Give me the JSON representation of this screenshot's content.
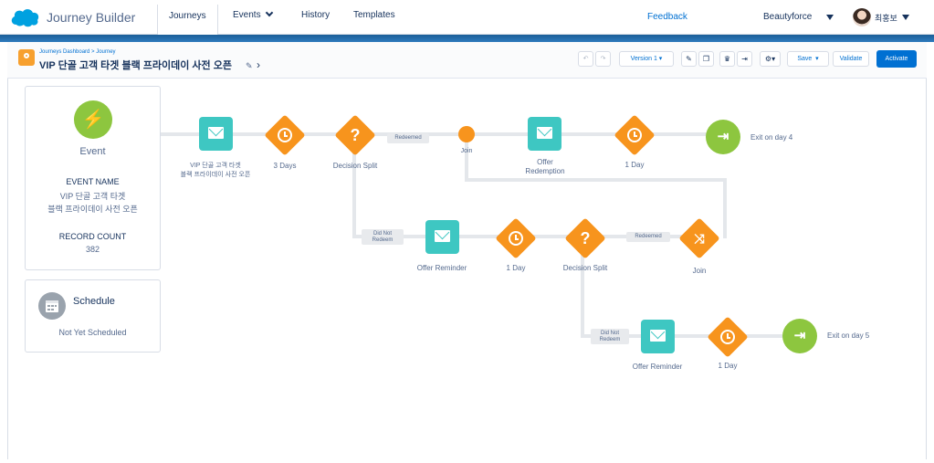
{
  "nav": {
    "app_title": "Journey Builder",
    "tabs": [
      "Journeys",
      "Events",
      "History",
      "Templates"
    ],
    "feedback": "Feedback",
    "org": "Beautyforce",
    "user": "최홍보"
  },
  "header": {
    "breadcrumb": "Journeys Dashboard > Journey",
    "title": "VIP 단골 고객 타겟 블랙 프라이데이 사전 오픈",
    "version": "Version 1",
    "save": "Save",
    "validate": "Validate",
    "activate": "Activate"
  },
  "event_card": {
    "label": "Event",
    "name_heading": "EVENT NAME",
    "name_line1": "VIP 단골 고객 타겟",
    "name_line2": "블랙 프라이데이 사전 오픈",
    "count_heading": "RECORD COUNT",
    "count": "382"
  },
  "schedule_card": {
    "label": "Schedule",
    "status": "Not Yet Scheduled"
  },
  "flow": {
    "email1_line1": "VIP 단골 고객 타겟",
    "email1_line2": "블랙 프라이데이 사전 오픈",
    "wait1": "3 Days",
    "split1": "Decision Split",
    "redeemed1": "Redeemed",
    "join1": "Join",
    "offer_line1": "Offer",
    "offer_line2": "Redemption",
    "wait2": "1 Day",
    "exit1": "Exit on day 4",
    "did_not1_line1": "Did Not",
    "did_not1_line2": "Redeem",
    "reminder1": "Offer Reminder",
    "wait3": "1 Day",
    "split2": "Decision Split",
    "redeemed2": "Redeemed",
    "join2": "Join",
    "did_not2_line1": "Did Not",
    "did_not2_line2": "Redeem",
    "reminder2": "Offer Reminder",
    "wait4": "1 Day",
    "exit2": "Exit on day 5"
  },
  "icons": {
    "logo": "salesforce-cloud-icon",
    "event": "lightning-bolt-icon",
    "schedule": "calendar-icon",
    "email": "envelope-icon",
    "wait": "clock-icon",
    "split": "question-mark-icon",
    "join": "merge-icon",
    "exit": "exit-door-icon"
  },
  "colors": {
    "accent_blue": "#0070d2",
    "email_teal": "#3ec7c2",
    "activity_orange": "#f7941d",
    "event_green": "#8dc63f",
    "band_blue": "#1b5e98"
  }
}
